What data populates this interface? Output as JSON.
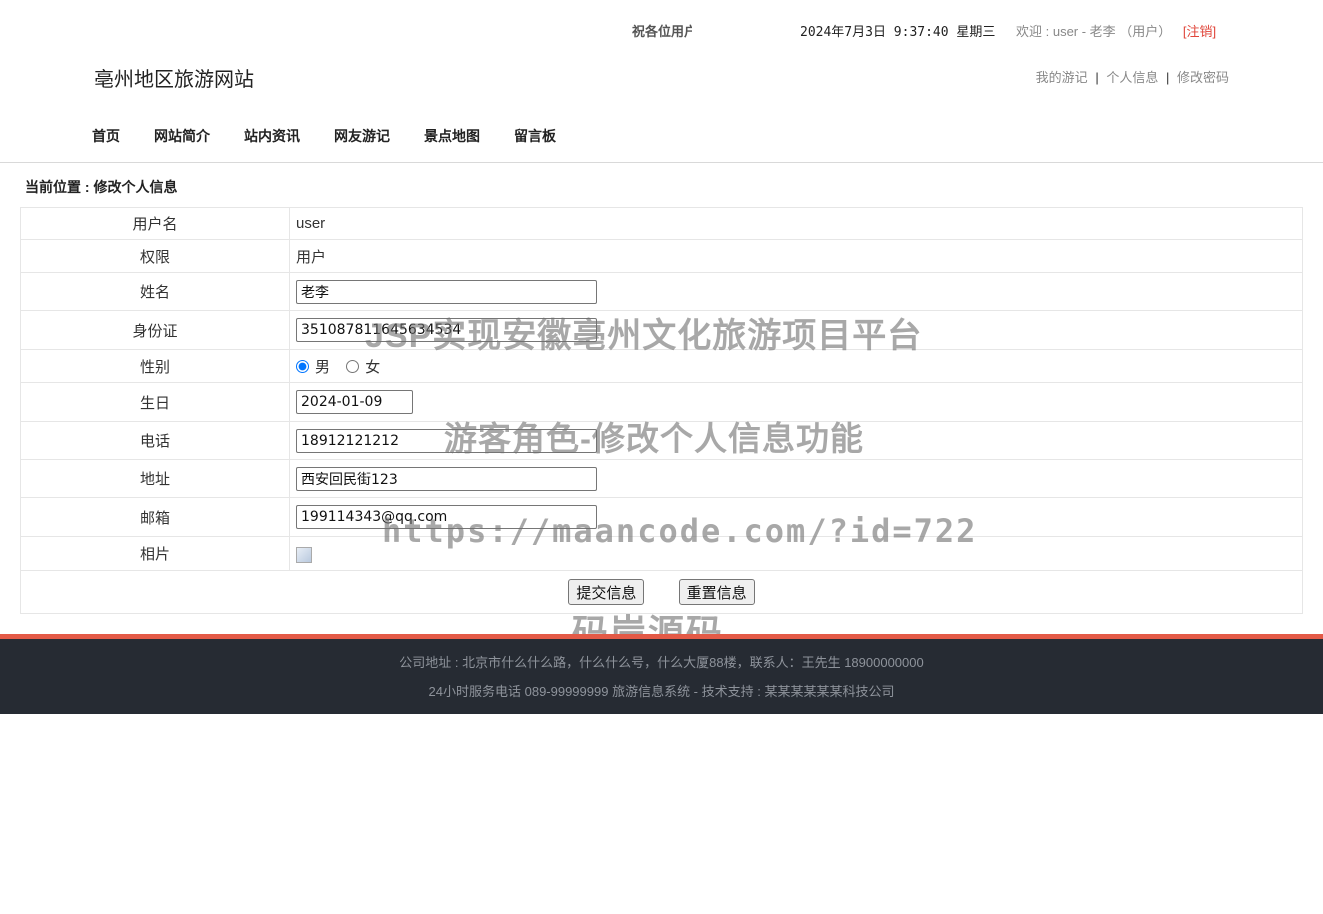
{
  "topbar": {
    "marquee": "祝各位用户",
    "datetime": "2024年7月3日 9:37:40 星期三",
    "welcome_prefix": "欢迎 : user - 老李 （用户）",
    "logout": "[注销]"
  },
  "site_title": "亳州地区旅游网站",
  "userlinks": {
    "travelogue": "我的游记",
    "profile": "个人信息",
    "password": "修改密码",
    "sep": "|"
  },
  "nav": [
    "首页",
    "网站简介",
    "站内资讯",
    "网友游记",
    "景点地图",
    "留言板"
  ],
  "breadcrumb": "当前位置 : 修改个人信息",
  "form": {
    "username_label": "用户名",
    "username_value": "user",
    "role_label": "权限",
    "role_value": "用户",
    "name_label": "姓名",
    "name_value": "老李",
    "idcard_label": "身份证",
    "idcard_value": "351087811645634534",
    "gender_label": "性别",
    "gender_options": [
      "男",
      "女"
    ],
    "gender_selected": "男",
    "birthday_label": "生日",
    "birthday_value": "2024-01-09",
    "phone_label": "电话",
    "phone_value": "18912121212",
    "address_label": "地址",
    "address_value": "西安回民街123",
    "email_label": "邮箱",
    "email_value": "199114343@qq.com",
    "photo_label": "相片",
    "submit": "提交信息",
    "reset": "重置信息"
  },
  "watermark": {
    "line1": "JSP实现安徽亳州文化旅游项目平台",
    "line2": "游客角色-修改个人信息功能",
    "line3": "https://maancode.com/?id=722",
    "line4": "码岸源码"
  },
  "footer": {
    "line1": "公司地址 : 北京市什么什么路，什么什么号，什么大厦88楼，联系人：王先生 18900000000",
    "line2": "24小时服务电话   089-99999999   旅游信息系统 - 技术支持 : 某某某某某某科技公司"
  },
  "colors": {
    "accent": "#e35a47",
    "footer_bg": "#262b33",
    "logout": "#e0453a"
  }
}
